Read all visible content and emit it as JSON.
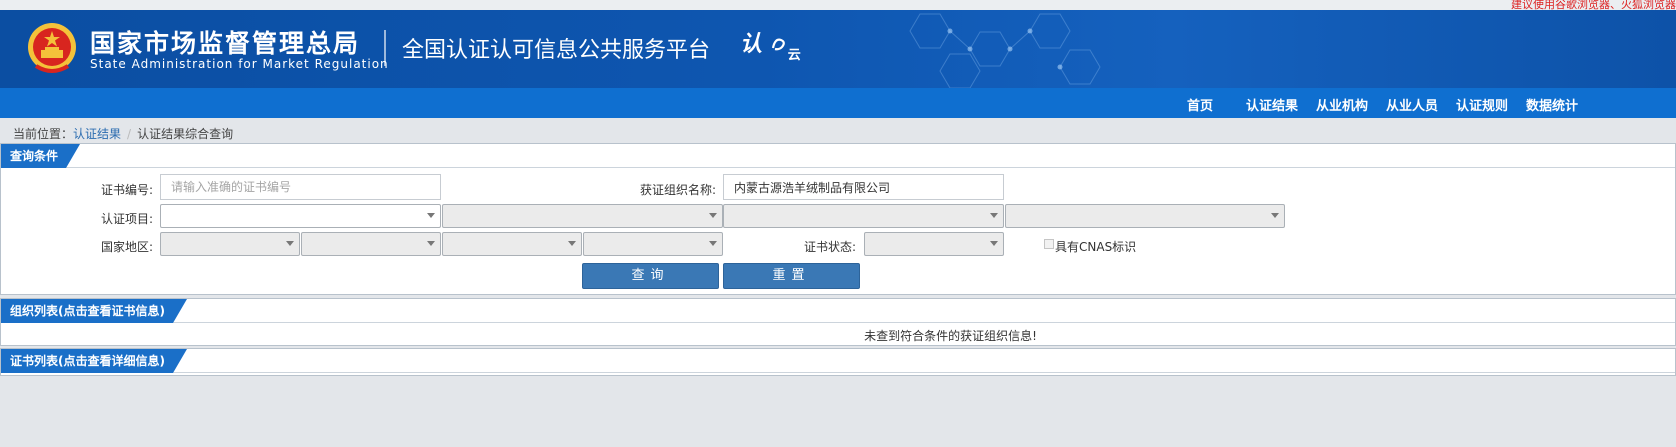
{
  "top_hint": "建议使用谷歌浏览器、火狐浏览器",
  "header": {
    "agency_cn": "国家市场监督管理总局",
    "agency_en": "State Administration  for  Market Regulation",
    "platform": "全国认证认可信息公共服务平台",
    "logo_text": "认",
    "logo_sub": "云"
  },
  "nav": [
    "首页",
    "认证结果",
    "从业机构",
    "从业人员",
    "认证规则",
    "数据统计"
  ],
  "breadcrumb": {
    "prefix": "当前位置：",
    "link": "认证结果",
    "separator": "/",
    "current": "认证结果综合查询"
  },
  "query": {
    "tab": "查询条件",
    "cert_no_label": "证书编号:",
    "cert_no_placeholder": "请输入准确的证书编号",
    "cert_no_value": "",
    "org_name_label": "获证组织名称:",
    "org_name_value": "内蒙古源浩羊绒制品有限公司",
    "project_label": "认证项目:",
    "region_label": "国家地区:",
    "status_label": "证书状态:",
    "cnas_label": "具有CNAS标识",
    "cnas_checked": false,
    "search_button": "查询",
    "reset_button": "重置"
  },
  "org_list": {
    "tab": "组织列表(点击查看证书信息)",
    "empty_message": "未查到符合条件的获证组织信息!"
  },
  "cert_list": {
    "tab": "证书列表(点击查看详细信息)"
  },
  "colors": {
    "header_blue": "#0b4ea2",
    "nav_blue": "#0f6fd0",
    "tab_blue": "#1a6fc8",
    "button_blue": "#3a78b5"
  }
}
